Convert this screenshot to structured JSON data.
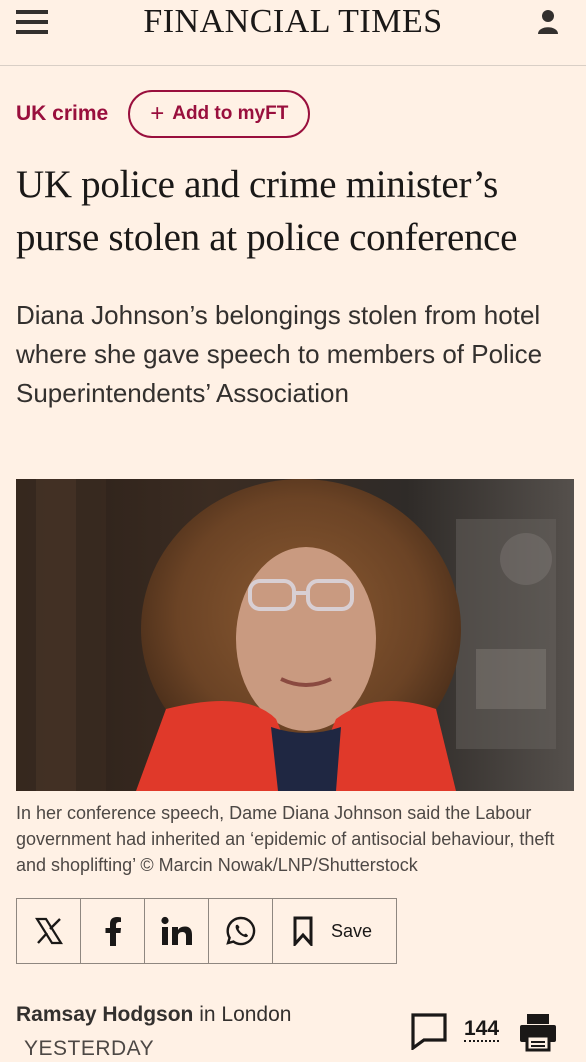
{
  "header": {
    "brand": "FINANCIAL TIMES",
    "menu_icon": "hamburger-menu-icon",
    "user_icon": "user-account-icon"
  },
  "article": {
    "kicker": "UK crime",
    "add_myft": "Add to myFT",
    "headline": "UK police and crime minister’s purse stolen at police conference",
    "standfirst": "Diana Johnson’s belongings stolen from hotel where she gave speech to members of Police Superintendents’ Association",
    "caption": "In her conference speech, Dame Diana Johnson said the Labour government had inherited an ‘epidemic of antisocial behaviour, theft and shoplifting’ © Marcin Nowak/LNP/Shutterstock",
    "save_label": "Save",
    "author": "Ramsay Hodgson",
    "location": "in London",
    "timestamp": "YESTERDAY",
    "comment_count": "144"
  },
  "share": {
    "icons": [
      "x-icon",
      "facebook-icon",
      "linkedin-icon",
      "whatsapp-icon",
      "bookmark-icon"
    ]
  },
  "colors": {
    "background": "#fff1e5",
    "accent": "#990f3d",
    "text": "#33302e"
  }
}
